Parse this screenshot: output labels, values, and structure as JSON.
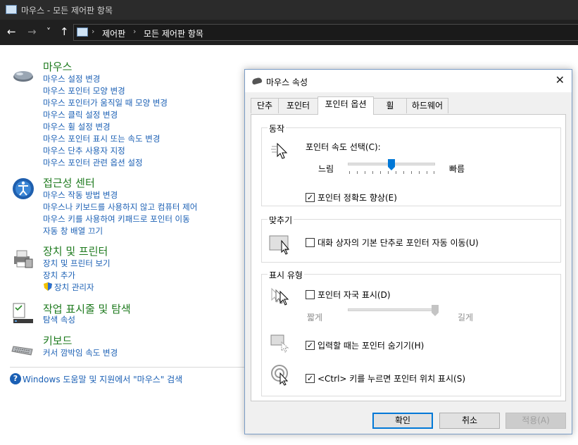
{
  "window": {
    "title": "마우스 - 모든 제어판 항목"
  },
  "nav": {
    "back": "←",
    "forward": "→",
    "recent": "˅",
    "up": "↑",
    "breadcrumb": [
      "제어판",
      "모든 제어판 항목"
    ],
    "separator": "›"
  },
  "categories": [
    {
      "title": "마우스",
      "icon": "mouse-icon",
      "links": [
        "마우스 설정 변경",
        "마우스 포인터 모양 변경",
        "마우스 포인터가 움직일 때 모양 변경",
        "마우스 클릭 설정 변경",
        "마우스 휠 설정 변경",
        "마우스 포인터 표시 또는 속도 변경",
        "마우스 단추 사용자 지정",
        "마우스 포인터 관련 옵션 설정"
      ]
    },
    {
      "title": "접근성 센터",
      "icon": "accessibility-icon",
      "links": [
        "마우스 작동 방법 변경",
        "마우스나 키보드를 사용하지 않고 컴퓨터 제어",
        "마우스 키를 사용하여 키패드로 포인터 이동",
        "자동 창 배열 끄기"
      ]
    },
    {
      "title": "장치 및 프린터",
      "icon": "printer-icon",
      "links": [
        "장치 및 프린터 보기",
        "장치 추가",
        "장치 관리자"
      ]
    },
    {
      "title": "작업 표시줄 및 탐색",
      "icon": "taskbar-icon",
      "links": [
        "탐색 속성"
      ]
    },
    {
      "title": "키보드",
      "icon": "keyboard-icon",
      "links": [
        "커서 깜박임 속도 변경"
      ]
    }
  ],
  "help": {
    "text": "Windows 도움말 및 지원에서 \"마우스\" 검색"
  },
  "dialog": {
    "title": "마우스 속성",
    "close": "✕",
    "tabs": [
      "단추",
      "포인터",
      "포인터 옵션",
      "휠",
      "하드웨어"
    ],
    "active_tab": "포인터 옵션",
    "motion": {
      "group_title": "동작",
      "speed_label": "포인터 속도 선택(C):",
      "slow": "느림",
      "fast": "빠름",
      "speed_level": 0.5,
      "precision": {
        "label": "포인터 정확도 향상(E)",
        "checked": true
      }
    },
    "snap": {
      "group_title": "맞추기",
      "checkbox": {
        "label": "대화 상자의 기본 단추로 포인터 자동 이동(U)",
        "checked": false
      }
    },
    "visibility": {
      "group_title": "표시 유형",
      "trails": {
        "label": "포인터 자국 표시(D)",
        "checked": false
      },
      "short": "짧게",
      "long": "길게",
      "trail_level": 1.0,
      "hide": {
        "label": "입력할 때는 포인터 숨기기(H)",
        "checked": true
      },
      "ctrl": {
        "label": "<Ctrl> 키를 누르면 포인터 위치 표시(S)",
        "checked": true
      }
    },
    "buttons": {
      "ok": "확인",
      "cancel": "취소",
      "apply": "적용(A)"
    }
  },
  "check_glyph": "✓",
  "colors": {
    "link": "#1a5fb4",
    "category": "#1e7a1e",
    "accent": "#0078d7"
  }
}
